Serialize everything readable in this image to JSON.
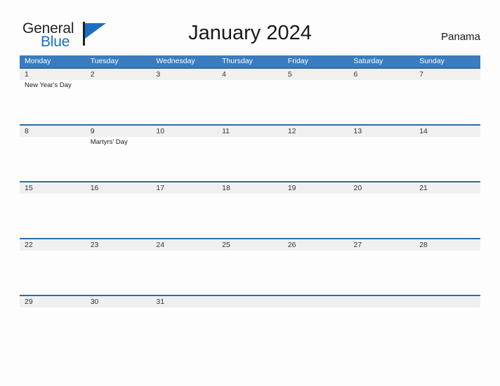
{
  "brand": {
    "name_part1": "General",
    "name_part2": "Blue",
    "flag_icon": "blue-triangle-flag-icon",
    "color_dark": "#231f20",
    "color_blue": "#1a6fc4"
  },
  "header": {
    "title": "January 2024",
    "locale": "Panama"
  },
  "theme": {
    "header_blue": "#3a7cbe",
    "row_rule_blue": "#2b6ca8",
    "date_band_gray": "#f0f0f0",
    "page_background": "#fdfdfd"
  },
  "calendar": {
    "month": "January",
    "year": "2024",
    "weekday_headers": [
      "Monday",
      "Tuesday",
      "Wednesday",
      "Thursday",
      "Friday",
      "Saturday",
      "Sunday"
    ],
    "weeks": [
      {
        "days": [
          {
            "date": "1",
            "events": [
              "New Year's Day"
            ]
          },
          {
            "date": "2",
            "events": []
          },
          {
            "date": "3",
            "events": []
          },
          {
            "date": "4",
            "events": []
          },
          {
            "date": "5",
            "events": []
          },
          {
            "date": "6",
            "events": []
          },
          {
            "date": "7",
            "events": []
          }
        ]
      },
      {
        "days": [
          {
            "date": "8",
            "events": []
          },
          {
            "date": "9",
            "events": [
              "Martyrs' Day"
            ]
          },
          {
            "date": "10",
            "events": []
          },
          {
            "date": "11",
            "events": []
          },
          {
            "date": "12",
            "events": []
          },
          {
            "date": "13",
            "events": []
          },
          {
            "date": "14",
            "events": []
          }
        ]
      },
      {
        "days": [
          {
            "date": "15",
            "events": []
          },
          {
            "date": "16",
            "events": []
          },
          {
            "date": "17",
            "events": []
          },
          {
            "date": "18",
            "events": []
          },
          {
            "date": "19",
            "events": []
          },
          {
            "date": "20",
            "events": []
          },
          {
            "date": "21",
            "events": []
          }
        ]
      },
      {
        "days": [
          {
            "date": "22",
            "events": []
          },
          {
            "date": "23",
            "events": []
          },
          {
            "date": "24",
            "events": []
          },
          {
            "date": "25",
            "events": []
          },
          {
            "date": "26",
            "events": []
          },
          {
            "date": "27",
            "events": []
          },
          {
            "date": "28",
            "events": []
          }
        ]
      },
      {
        "days": [
          {
            "date": "29",
            "events": []
          },
          {
            "date": "30",
            "events": []
          },
          {
            "date": "31",
            "events": []
          },
          {
            "date": "",
            "events": []
          },
          {
            "date": "",
            "events": []
          },
          {
            "date": "",
            "events": []
          },
          {
            "date": "",
            "events": []
          }
        ]
      }
    ]
  }
}
